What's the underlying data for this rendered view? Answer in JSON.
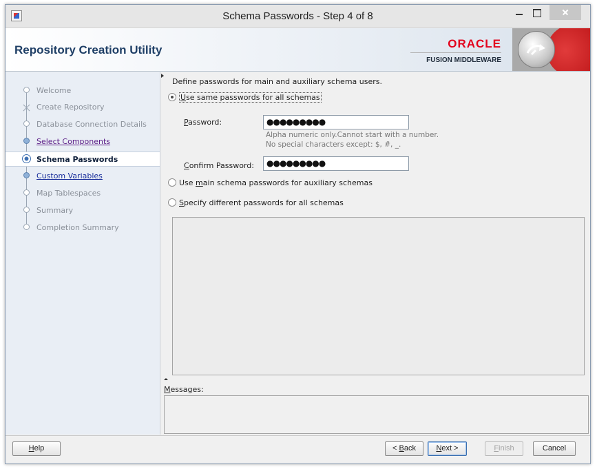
{
  "window": {
    "title": "Schema Passwords - Step 4 of 8"
  },
  "header": {
    "title": "Repository Creation Utility",
    "brand": "ORACLE",
    "product": "FUSION MIDDLEWARE",
    "brand_color": "#e3001b"
  },
  "sidebar": {
    "items": [
      {
        "label": "Welcome",
        "state": "disabled"
      },
      {
        "label": "Create Repository",
        "state": "disabled"
      },
      {
        "label": "Database Connection Details",
        "state": "disabled"
      },
      {
        "label": "Select Components",
        "state": "visited"
      },
      {
        "label": "Schema Passwords",
        "state": "active"
      },
      {
        "label": "Custom Variables",
        "state": "link"
      },
      {
        "label": "Map Tablespaces",
        "state": "disabled"
      },
      {
        "label": "Summary",
        "state": "disabled"
      },
      {
        "label": "Completion Summary",
        "state": "disabled"
      }
    ]
  },
  "main": {
    "intro": "Define passwords for main and auxiliary schema users.",
    "options": [
      {
        "pre": "",
        "u": "U",
        "post": "se same passwords for all schemas",
        "checked": true
      },
      {
        "pre": "Use ",
        "u": "m",
        "post": "ain schema passwords for auxiliary schemas",
        "checked": false
      },
      {
        "pre": "",
        "u": "S",
        "post": "pecify different passwords for all schemas",
        "checked": false
      }
    ],
    "password": {
      "label_u": "P",
      "label_rest": "assword:",
      "value": "●●●●●●●●●",
      "hint1": "Alpha numeric only.Cannot start with a number.",
      "hint2": "No special characters except: $, #, _."
    },
    "confirm": {
      "label_u": "C",
      "label_rest": "onfirm Password:",
      "value": "●●●●●●●●●"
    },
    "messages": {
      "label_u": "M",
      "label_rest": "essages:"
    }
  },
  "footer": {
    "help": {
      "u": "H",
      "rest": "elp"
    },
    "back": {
      "pre": "< ",
      "u": "B",
      "rest": "ack"
    },
    "next": {
      "u": "N",
      "rest": "ext >"
    },
    "finish": {
      "u": "F",
      "rest": "inish"
    },
    "cancel": "Cancel"
  },
  "icons": [
    "app-icon",
    "minimize-icon",
    "maximize-icon",
    "close-icon",
    "oracle-graphic-icon"
  ]
}
